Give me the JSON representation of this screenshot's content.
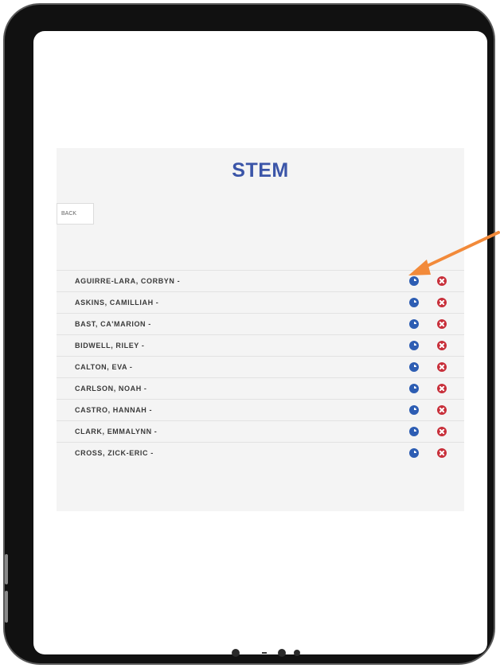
{
  "page": {
    "title": "STEM",
    "back_label": "BACK"
  },
  "students": [
    {
      "name": "AGUIRRE-LARA, CORBYN -"
    },
    {
      "name": "ASKINS, CAMILLIAH -"
    },
    {
      "name": "BAST, CA'MARION -"
    },
    {
      "name": "BIDWELL, RILEY -"
    },
    {
      "name": "CALTON, EVA -"
    },
    {
      "name": "CARLSON, NOAH -"
    },
    {
      "name": "CASTRO, HANNAH -"
    },
    {
      "name": "CLARK, EMMALYNN -"
    },
    {
      "name": "CROSS, ZICK-ERIC -"
    }
  ],
  "icons": {
    "row_action_1": "edit-icon",
    "row_action_2": "delete-icon"
  },
  "colors": {
    "title": "#3b55a8",
    "edit": "#2d5db3",
    "delete": "#c8303b",
    "annotation_arrow": "#f28a3a"
  }
}
